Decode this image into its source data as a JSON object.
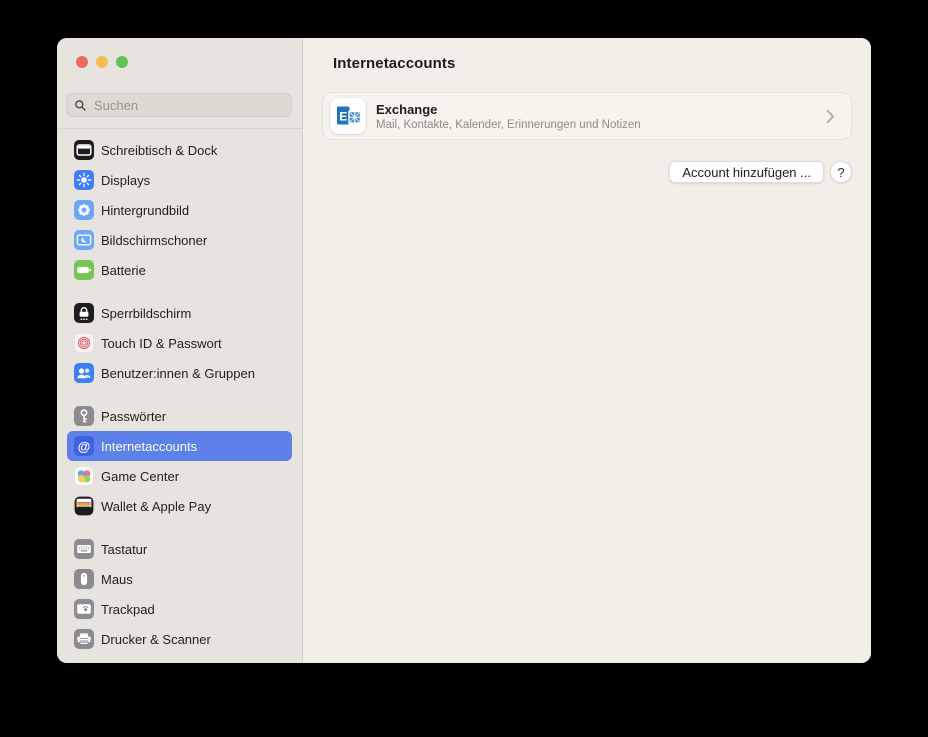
{
  "colors": {
    "accent_selection": "#5d81e9",
    "sidebar_bg": "#e7e4df",
    "main_bg": "#f2efe9",
    "card_bg": "#f7f4ee",
    "traffic_close": "#ee6a5f",
    "traffic_minimize": "#f5bd4f",
    "traffic_zoom": "#61c354",
    "exchange_blue": "#2273b8"
  },
  "sidebar": {
    "search": {
      "placeholder": "Suchen",
      "icon": "search-icon"
    },
    "groups": [
      {
        "items": [
          {
            "label": "Schreibtisch & Dock",
            "icon": "desktop-dock-icon"
          },
          {
            "label": "Displays",
            "icon": "displays-icon"
          },
          {
            "label": "Hintergrundbild",
            "icon": "wallpaper-icon"
          },
          {
            "label": "Bildschirmschoner",
            "icon": "screensaver-icon"
          },
          {
            "label": "Batterie",
            "icon": "battery-icon"
          }
        ]
      },
      {
        "items": [
          {
            "label": "Sperrbildschirm",
            "icon": "lock-screen-icon"
          },
          {
            "label": "Touch ID & Passwort",
            "icon": "touch-id-icon"
          },
          {
            "label": "Benutzer:innen & Gruppen",
            "icon": "users-groups-icon"
          }
        ]
      },
      {
        "items": [
          {
            "label": "Passwörter",
            "icon": "passwords-key-icon"
          },
          {
            "label": "Internetaccounts",
            "icon": "internet-accounts-at-icon",
            "icon_glyph": "@",
            "selected": true
          },
          {
            "label": "Game Center",
            "icon": "game-center-icon"
          },
          {
            "label": "Wallet & Apple Pay",
            "icon": "wallet-icon"
          }
        ]
      },
      {
        "items": [
          {
            "label": "Tastatur",
            "icon": "keyboard-icon"
          },
          {
            "label": "Maus",
            "icon": "mouse-icon"
          },
          {
            "label": "Trackpad",
            "icon": "trackpad-icon"
          },
          {
            "label": "Drucker & Scanner",
            "icon": "printer-icon"
          }
        ]
      }
    ]
  },
  "main": {
    "title": "Internetaccounts",
    "accounts": [
      {
        "name": "Exchange",
        "description": "Mail, Kontakte, Kalender, Erinnerungen und Notizen",
        "icon": "exchange-logo-icon",
        "chevron_icon": "chevron-right-icon"
      }
    ],
    "add_account_label": "Account hinzufügen ...",
    "help_label": "?"
  }
}
